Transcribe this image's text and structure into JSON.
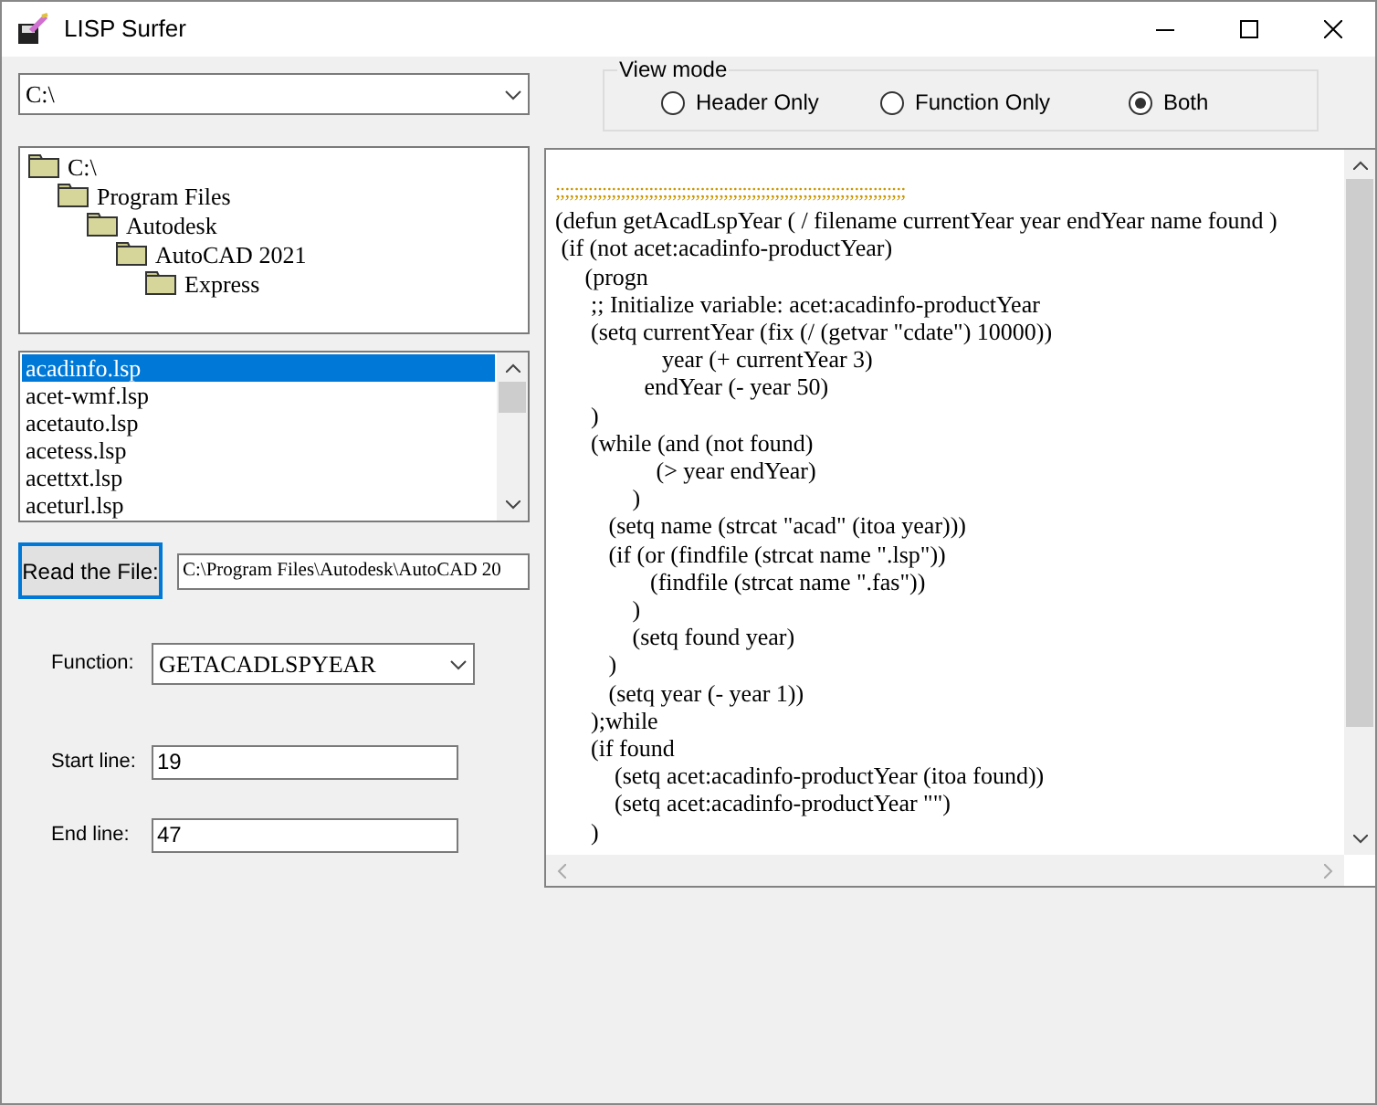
{
  "window": {
    "title": "LISP Surfer"
  },
  "drive_combo": {
    "value": "C:\\"
  },
  "view_mode": {
    "label": "View mode",
    "options": [
      {
        "label": "Header Only",
        "selected": false
      },
      {
        "label": "Function Only",
        "selected": false
      },
      {
        "label": "Both",
        "selected": true
      }
    ]
  },
  "folder_tree": [
    {
      "label": "C:\\",
      "children": [
        {
          "label": "Program Files",
          "children": [
            {
              "label": "Autodesk",
              "children": [
                {
                  "label": "AutoCAD 2021",
                  "children": [
                    {
                      "label": "Express"
                    }
                  ]
                }
              ]
            }
          ]
        }
      ]
    }
  ],
  "files": [
    {
      "label": "acadinfo.lsp",
      "selected": true
    },
    {
      "label": "acet-wmf.lsp",
      "selected": false
    },
    {
      "label": "acetauto.lsp",
      "selected": false
    },
    {
      "label": "acetess.lsp",
      "selected": false
    },
    {
      "label": "acettxt.lsp",
      "selected": false
    },
    {
      "label": "aceturl.lsp",
      "selected": false
    }
  ],
  "read_button": "Read the File:",
  "file_path": "C:\\Program Files\\Autodesk\\AutoCAD 20",
  "function": {
    "label": "Function:",
    "value": "GETACADLSPYEAR"
  },
  "start_line": {
    "label": "Start line:",
    "value": "19"
  },
  "end_line": {
    "label": "End line:",
    "value": "47"
  },
  "code": {
    "separator": ";;;;;;;;;;;;;;;;;;;;;;;;;;;;;;;;;;;;;;;;;;;;;;;;;;;;;;;;;;;;;;;;;;;;;;;;;;;",
    "lines": [
      "(defun getAcadLspYear ( / filename currentYear year endYear name found )",
      " (if (not acet:acadinfo-productYear)",
      "     (progn",
      "      ;; Initialize variable: acet:acadinfo-productYear",
      "      (setq currentYear (fix (/ (getvar \"cdate\") 10000))",
      "                  year (+ currentYear 3)",
      "               endYear (- year 50)",
      "      )",
      "      (while (and (not found)",
      "                 (> year endYear)",
      "             )",
      "         (setq name (strcat \"acad\" (itoa year)))",
      "         (if (or (findfile (strcat name \".lsp\"))",
      "                (findfile (strcat name \".fas\"))",
      "             )",
      "             (setq found year)",
      "         )",
      "         (setq year (- year 1))",
      "      );while",
      "      (if found",
      "          (setq acet:acadinfo-productYear (itoa found))",
      "          (setq acet:acadinfo-productYear \"\")",
      "      )"
    ]
  }
}
